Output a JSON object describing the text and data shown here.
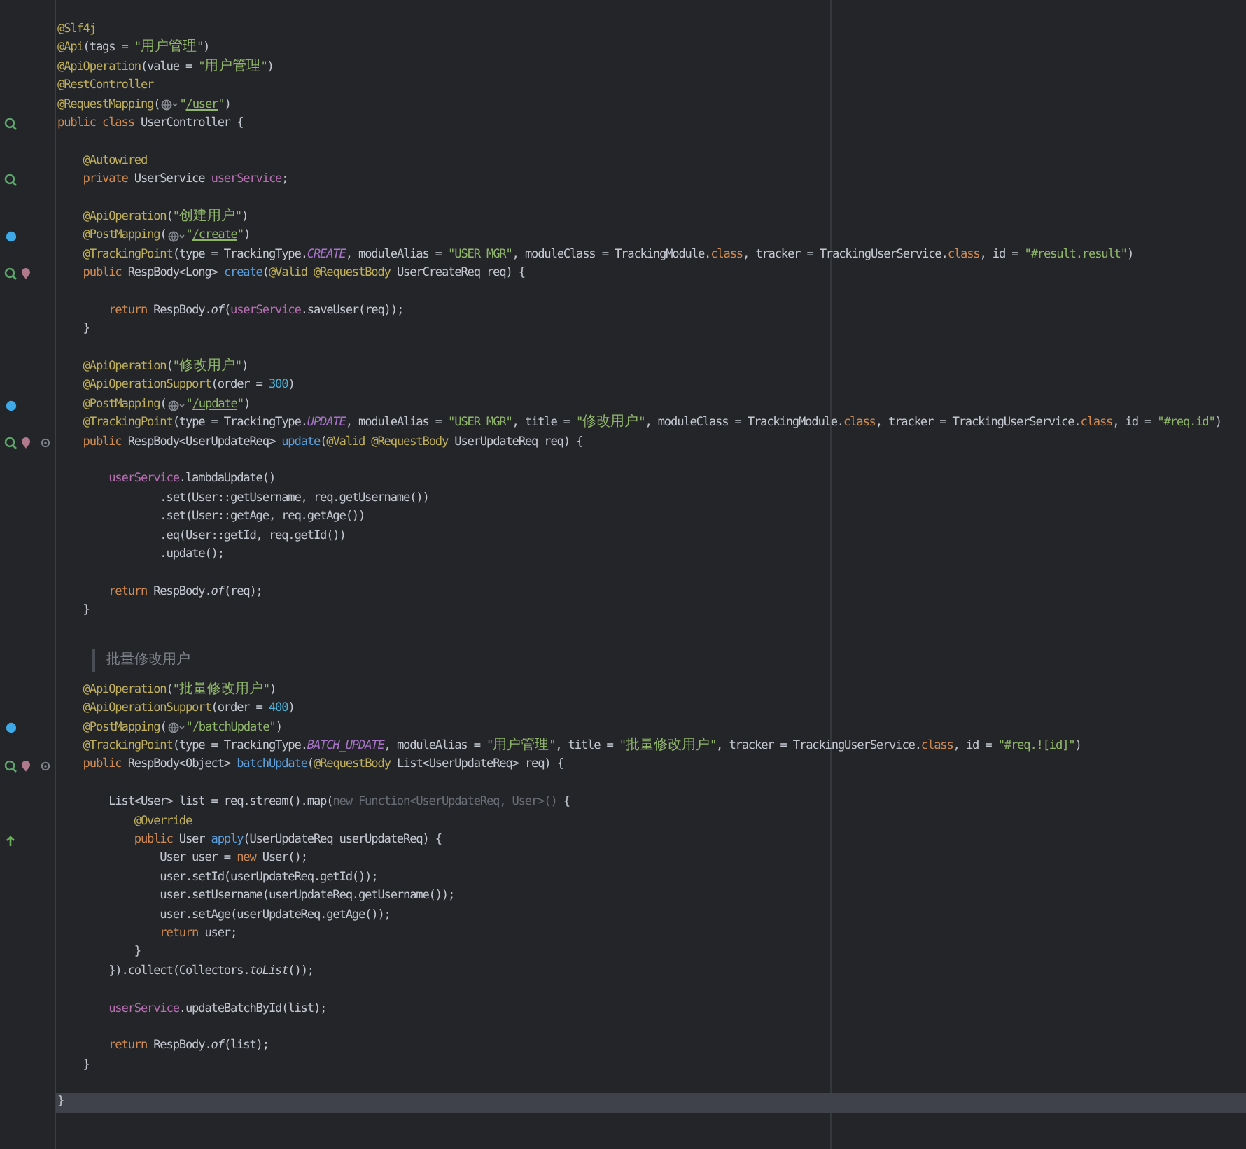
{
  "editor": {
    "lines": [
      {
        "kind": "code",
        "current": false,
        "tokens": [
          {
            "kind": "annotation",
            "text": "@Slf4j"
          }
        ]
      },
      {
        "kind": "code",
        "current": false,
        "tokens": [
          {
            "kind": "annotation",
            "text": "@Api"
          },
          {
            "kind": "plain",
            "text": "(tags = "
          },
          {
            "kind": "string",
            "text": "\"用户管理\""
          },
          {
            "kind": "plain",
            "text": ")"
          }
        ]
      },
      {
        "kind": "code",
        "current": false,
        "tokens": [
          {
            "kind": "annotation",
            "text": "@ApiOperation"
          },
          {
            "kind": "plain",
            "text": "(value = "
          },
          {
            "kind": "string",
            "text": "\"用户管理\""
          },
          {
            "kind": "plain",
            "text": ")"
          }
        ]
      },
      {
        "kind": "code",
        "current": false,
        "tokens": [
          {
            "kind": "annotation",
            "text": "@RestController"
          }
        ]
      },
      {
        "kind": "code",
        "current": false,
        "tokens": [
          {
            "kind": "annotation",
            "text": "@RequestMapping"
          },
          {
            "kind": "plain",
            "text": "("
          },
          {
            "kind": "globe"
          },
          {
            "kind": "string",
            "text": "\""
          },
          {
            "kind": "link",
            "text": "/user"
          },
          {
            "kind": "string",
            "text": "\""
          },
          {
            "kind": "plain",
            "text": ")"
          }
        ]
      },
      {
        "kind": "code",
        "current": false,
        "gutter": [
          {
            "kind": "bean"
          }
        ],
        "tokens": [
          {
            "kind": "keyword",
            "text": "public class "
          },
          {
            "kind": "plain",
            "text": "UserController {"
          }
        ]
      },
      {
        "kind": "code",
        "current": false
      },
      {
        "kind": "code",
        "current": false,
        "tokens": [
          {
            "kind": "annotation",
            "text": "    @Autowired"
          }
        ]
      },
      {
        "kind": "code",
        "current": false,
        "gutter": [
          {
            "kind": "bean"
          }
        ],
        "tokens": [
          {
            "kind": "keyword",
            "text": "    private "
          },
          {
            "kind": "plain",
            "text": "UserService "
          },
          {
            "kind": "field",
            "text": "userService"
          },
          {
            "kind": "plain",
            "text": ";"
          }
        ]
      },
      {
        "kind": "code",
        "current": false
      },
      {
        "kind": "code",
        "current": false,
        "tokens": [
          {
            "kind": "annotation",
            "text": "    @ApiOperation"
          },
          {
            "kind": "plain",
            "text": "("
          },
          {
            "kind": "string",
            "text": "\"创建用户\""
          },
          {
            "kind": "plain",
            "text": ")"
          }
        ]
      },
      {
        "kind": "code",
        "current": false,
        "gutter": [
          {
            "kind": "endpoint"
          }
        ],
        "tokens": [
          {
            "kind": "annotation",
            "text": "    @PostMapping"
          },
          {
            "kind": "plain",
            "text": "("
          },
          {
            "kind": "globe"
          },
          {
            "kind": "string",
            "text": "\""
          },
          {
            "kind": "link",
            "text": "/create"
          },
          {
            "kind": "string",
            "text": "\""
          },
          {
            "kind": "plain",
            "text": ")"
          }
        ]
      },
      {
        "kind": "code",
        "current": false,
        "tokens": [
          {
            "kind": "annotation",
            "text": "    @TrackingPoint"
          },
          {
            "kind": "plain",
            "text": "(type = TrackingType."
          },
          {
            "kind": "constant",
            "text": "CREATE"
          },
          {
            "kind": "plain",
            "text": ", moduleAlias = "
          },
          {
            "kind": "string",
            "text": "\"USER_MGR\""
          },
          {
            "kind": "plain",
            "text": ", moduleClass = TrackingModule."
          },
          {
            "kind": "keyword",
            "text": "class"
          },
          {
            "kind": "plain",
            "text": ", tracker = TrackingUserService."
          },
          {
            "kind": "keyword",
            "text": "class"
          },
          {
            "kind": "plain",
            "text": ", id = "
          },
          {
            "kind": "string",
            "text": "\"#result.result\""
          },
          {
            "kind": "plain",
            "text": ")"
          }
        ]
      },
      {
        "kind": "code",
        "current": false,
        "gutter": [
          {
            "kind": "bean"
          },
          {
            "kind": "tracking"
          }
        ],
        "tokens": [
          {
            "kind": "keyword",
            "text": "    public "
          },
          {
            "kind": "plain",
            "text": "RespBody<Long> "
          },
          {
            "kind": "method",
            "text": "create"
          },
          {
            "kind": "plain",
            "text": "("
          },
          {
            "kind": "annotation",
            "text": "@Valid @RequestBody "
          },
          {
            "kind": "plain",
            "text": "UserCreateReq req) {"
          }
        ]
      },
      {
        "kind": "code",
        "current": false
      },
      {
        "kind": "code",
        "current": false,
        "tokens": [
          {
            "kind": "keyword",
            "text": "        return "
          },
          {
            "kind": "plain",
            "text": "RespBody."
          },
          {
            "kind": "static",
            "text": "of"
          },
          {
            "kind": "plain",
            "text": "("
          },
          {
            "kind": "field",
            "text": "userService"
          },
          {
            "kind": "plain",
            "text": ".saveUser(req));"
          }
        ]
      },
      {
        "kind": "code",
        "current": false,
        "tokens": [
          {
            "kind": "plain",
            "text": "    }"
          }
        ]
      },
      {
        "kind": "code",
        "current": false
      },
      {
        "kind": "code",
        "current": false,
        "tokens": [
          {
            "kind": "annotation",
            "text": "    @ApiOperation"
          },
          {
            "kind": "plain",
            "text": "("
          },
          {
            "kind": "string",
            "text": "\"修改用户\""
          },
          {
            "kind": "plain",
            "text": ")"
          }
        ]
      },
      {
        "kind": "code",
        "current": false,
        "tokens": [
          {
            "kind": "annotation",
            "text": "    @ApiOperationSupport"
          },
          {
            "kind": "plain",
            "text": "(order = "
          },
          {
            "kind": "number",
            "text": "300"
          },
          {
            "kind": "plain",
            "text": ")"
          }
        ]
      },
      {
        "kind": "code",
        "current": false,
        "gutter": [
          {
            "kind": "endpoint"
          }
        ],
        "tokens": [
          {
            "kind": "annotation",
            "text": "    @PostMapping"
          },
          {
            "kind": "plain",
            "text": "("
          },
          {
            "kind": "globe"
          },
          {
            "kind": "string",
            "text": "\""
          },
          {
            "kind": "link",
            "text": "/update"
          },
          {
            "kind": "string",
            "text": "\""
          },
          {
            "kind": "plain",
            "text": ")"
          }
        ]
      },
      {
        "kind": "code",
        "current": false,
        "tokens": [
          {
            "kind": "annotation",
            "text": "    @TrackingPoint"
          },
          {
            "kind": "plain",
            "text": "(type = TrackingType."
          },
          {
            "kind": "constant",
            "text": "UPDATE"
          },
          {
            "kind": "plain",
            "text": ", moduleAlias = "
          },
          {
            "kind": "string",
            "text": "\"USER_MGR\""
          },
          {
            "kind": "plain",
            "text": ", title = "
          },
          {
            "kind": "string",
            "text": "\"修改用户\""
          },
          {
            "kind": "plain",
            "text": ", moduleClass = TrackingModule."
          },
          {
            "kind": "keyword",
            "text": "class"
          },
          {
            "kind": "plain",
            "text": ", tracker = TrackingUserService."
          },
          {
            "kind": "keyword",
            "text": "class"
          },
          {
            "kind": "plain",
            "text": ", id = "
          },
          {
            "kind": "string",
            "text": "\"#req.id\""
          },
          {
            "kind": "plain",
            "text": ")"
          }
        ]
      },
      {
        "kind": "code",
        "current": false,
        "gutter": [
          {
            "kind": "bean"
          },
          {
            "kind": "tracking"
          },
          {
            "kind": "settings"
          }
        ],
        "tokens": [
          {
            "kind": "keyword",
            "text": "    public "
          },
          {
            "kind": "plain",
            "text": "RespBody<UserUpdateReq> "
          },
          {
            "kind": "method",
            "text": "update"
          },
          {
            "kind": "plain",
            "text": "("
          },
          {
            "kind": "annotation",
            "text": "@Valid @RequestBody "
          },
          {
            "kind": "plain",
            "text": "UserUpdateReq req) {"
          }
        ]
      },
      {
        "kind": "code",
        "current": false
      },
      {
        "kind": "code",
        "current": false,
        "tokens": [
          {
            "kind": "field",
            "text": "        userService"
          },
          {
            "kind": "plain",
            "text": ".lambdaUpdate()"
          }
        ]
      },
      {
        "kind": "code",
        "current": false,
        "tokens": [
          {
            "kind": "plain",
            "text": "                .set(User::getUsername, req.getUsername())"
          }
        ]
      },
      {
        "kind": "code",
        "current": false,
        "tokens": [
          {
            "kind": "plain",
            "text": "                .set(User::getAge, req.getAge())"
          }
        ]
      },
      {
        "kind": "code",
        "current": false,
        "tokens": [
          {
            "kind": "plain",
            "text": "                .eq(User::getId, req.getId())"
          }
        ]
      },
      {
        "kind": "code",
        "current": false,
        "tokens": [
          {
            "kind": "plain",
            "text": "                .update();"
          }
        ]
      },
      {
        "kind": "code",
        "current": false
      },
      {
        "kind": "code",
        "current": false,
        "tokens": [
          {
            "kind": "keyword",
            "text": "        return "
          },
          {
            "kind": "plain",
            "text": "RespBody."
          },
          {
            "kind": "static",
            "text": "of"
          },
          {
            "kind": "plain",
            "text": "(req);"
          }
        ]
      },
      {
        "kind": "code",
        "current": false,
        "tokens": [
          {
            "kind": "plain",
            "text": "    }"
          }
        ]
      },
      {
        "kind": "code",
        "current": false
      },
      {
        "kind": "doc",
        "current": false,
        "text": "批量修改用户"
      },
      {
        "kind": "code",
        "current": false,
        "tokens": [
          {
            "kind": "annotation",
            "text": "    @ApiOperation"
          },
          {
            "kind": "plain",
            "text": "("
          },
          {
            "kind": "string",
            "text": "\"批量修改用户\""
          },
          {
            "kind": "plain",
            "text": ")"
          }
        ]
      },
      {
        "kind": "code",
        "current": false,
        "tokens": [
          {
            "kind": "annotation",
            "text": "    @ApiOperationSupport"
          },
          {
            "kind": "plain",
            "text": "(order = "
          },
          {
            "kind": "number",
            "text": "400"
          },
          {
            "kind": "plain",
            "text": ")"
          }
        ]
      },
      {
        "kind": "code",
        "current": false,
        "gutter": [
          {
            "kind": "endpoint"
          }
        ],
        "tokens": [
          {
            "kind": "annotation",
            "text": "    @PostMapping"
          },
          {
            "kind": "plain",
            "text": "("
          },
          {
            "kind": "globe"
          },
          {
            "kind": "string",
            "text": "\"/batchUpdate\""
          },
          {
            "kind": "plain",
            "text": ")"
          }
        ]
      },
      {
        "kind": "code",
        "current": false,
        "tokens": [
          {
            "kind": "annotation",
            "text": "    @TrackingPoint"
          },
          {
            "kind": "plain",
            "text": "(type = TrackingType."
          },
          {
            "kind": "constant",
            "text": "BATCH_UPDATE"
          },
          {
            "kind": "plain",
            "text": ", moduleAlias = "
          },
          {
            "kind": "string",
            "text": "\"用户管理\""
          },
          {
            "kind": "plain",
            "text": ", title = "
          },
          {
            "kind": "string",
            "text": "\"批量修改用户\""
          },
          {
            "kind": "plain",
            "text": ", tracker = TrackingUserService."
          },
          {
            "kind": "keyword",
            "text": "class"
          },
          {
            "kind": "plain",
            "text": ", id = "
          },
          {
            "kind": "string",
            "text": "\"#req.![id]\""
          },
          {
            "kind": "plain",
            "text": ")"
          }
        ]
      },
      {
        "kind": "code",
        "current": false,
        "gutter": [
          {
            "kind": "bean"
          },
          {
            "kind": "tracking"
          },
          {
            "kind": "settings"
          }
        ],
        "tokens": [
          {
            "kind": "keyword",
            "text": "    public "
          },
          {
            "kind": "plain",
            "text": "RespBody<Object> "
          },
          {
            "kind": "method",
            "text": "batchUpdate"
          },
          {
            "kind": "plain",
            "text": "("
          },
          {
            "kind": "annotation",
            "text": "@RequestBody "
          },
          {
            "kind": "plain",
            "text": "List<UserUpdateReq> req) {"
          }
        ]
      },
      {
        "kind": "code",
        "current": false
      },
      {
        "kind": "code",
        "current": false,
        "tokens": [
          {
            "kind": "plain",
            "text": "        List<User> list = req.stream().map("
          },
          {
            "kind": "folded",
            "text": "new Function<UserUpdateReq, User>() "
          },
          {
            "kind": "plain",
            "text": "{"
          }
        ]
      },
      {
        "kind": "code",
        "current": false,
        "tokens": [
          {
            "kind": "annotation",
            "text": "            @Override"
          }
        ]
      },
      {
        "kind": "code",
        "current": false,
        "gutter": [
          {
            "kind": "override"
          }
        ],
        "tokens": [
          {
            "kind": "keyword",
            "text": "            public "
          },
          {
            "kind": "plain",
            "text": "User "
          },
          {
            "kind": "method",
            "text": "apply"
          },
          {
            "kind": "plain",
            "text": "(UserUpdateReq userUpdateReq) {"
          }
        ]
      },
      {
        "kind": "code",
        "current": false,
        "tokens": [
          {
            "kind": "plain",
            "text": "                User user = "
          },
          {
            "kind": "keyword",
            "text": "new "
          },
          {
            "kind": "plain",
            "text": "User();"
          }
        ]
      },
      {
        "kind": "code",
        "current": false,
        "tokens": [
          {
            "kind": "plain",
            "text": "                user.setId(userUpdateReq.getId());"
          }
        ]
      },
      {
        "kind": "code",
        "current": false,
        "tokens": [
          {
            "kind": "plain",
            "text": "                user.setUsername(userUpdateReq.getUsername());"
          }
        ]
      },
      {
        "kind": "code",
        "current": false,
        "tokens": [
          {
            "kind": "plain",
            "text": "                user.setAge(userUpdateReq.getAge());"
          }
        ]
      },
      {
        "kind": "code",
        "current": false,
        "tokens": [
          {
            "kind": "keyword",
            "text": "                return "
          },
          {
            "kind": "plain",
            "text": "user;"
          }
        ]
      },
      {
        "kind": "code",
        "current": false,
        "tokens": [
          {
            "kind": "plain",
            "text": "            }"
          }
        ]
      },
      {
        "kind": "code",
        "current": false,
        "tokens": [
          {
            "kind": "plain",
            "text": "        }).collect(Collectors."
          },
          {
            "kind": "static",
            "text": "toList"
          },
          {
            "kind": "plain",
            "text": "());"
          }
        ]
      },
      {
        "kind": "code",
        "current": false
      },
      {
        "kind": "code",
        "current": false,
        "tokens": [
          {
            "kind": "field",
            "text": "        userService"
          },
          {
            "kind": "plain",
            "text": ".updateBatchById(list);"
          }
        ]
      },
      {
        "kind": "code",
        "current": false
      },
      {
        "kind": "code",
        "current": false,
        "tokens": [
          {
            "kind": "keyword",
            "text": "        return "
          },
          {
            "kind": "plain",
            "text": "RespBody."
          },
          {
            "kind": "static",
            "text": "of"
          },
          {
            "kind": "plain",
            "text": "(list);"
          }
        ]
      },
      {
        "kind": "code",
        "current": false,
        "tokens": [
          {
            "kind": "plain",
            "text": "    }"
          }
        ]
      },
      {
        "kind": "code",
        "current": false
      },
      {
        "kind": "code",
        "current": true,
        "tokens": [
          {
            "kind": "plain",
            "text": "}"
          }
        ]
      }
    ]
  }
}
